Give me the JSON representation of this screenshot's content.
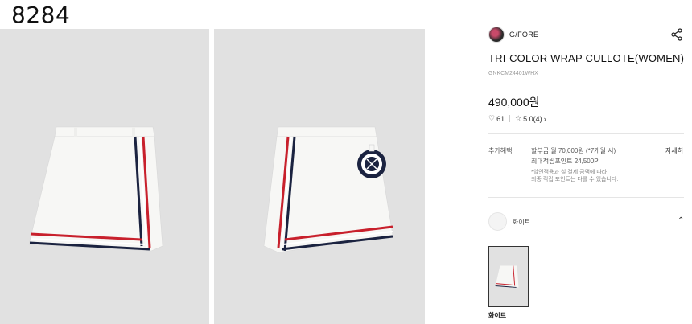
{
  "overlay_id": "8284",
  "gallery": {
    "images": [
      {
        "alt": "skirt-front"
      },
      {
        "alt": "skirt-side-with-ball-marker"
      }
    ]
  },
  "product": {
    "brand": "G/FORE",
    "title": "TRI-COLOR WRAP CULLOTE(WOMEN)",
    "code": "GNKCM24401WHX",
    "price": "490,000원",
    "likes": "61",
    "rating": "5.0(4)",
    "rating_arrow": "›"
  },
  "benefits": {
    "label": "추가혜택",
    "line1": "할부금 월 70,000원 (*7개월 시)",
    "line2": "최대적립포인트 24,500P",
    "note1": "*할인적용과 실 결제 금액에 따라",
    "note2": "최종 적립 포인트는 다를 수 있습니다.",
    "detail_link": "자세히"
  },
  "options": {
    "selected_color": "화이트",
    "thumb_label": "화이트"
  },
  "icons": {
    "share": "share-icon",
    "heart": "heart-icon",
    "star": "star-icon",
    "chevron": "chevron-up-icon"
  },
  "colors": {
    "skirt_white": "#f7f7f5",
    "stripe_red": "#c8202c",
    "stripe_navy": "#1b2340",
    "bg_gray": "#e1e1e1"
  }
}
